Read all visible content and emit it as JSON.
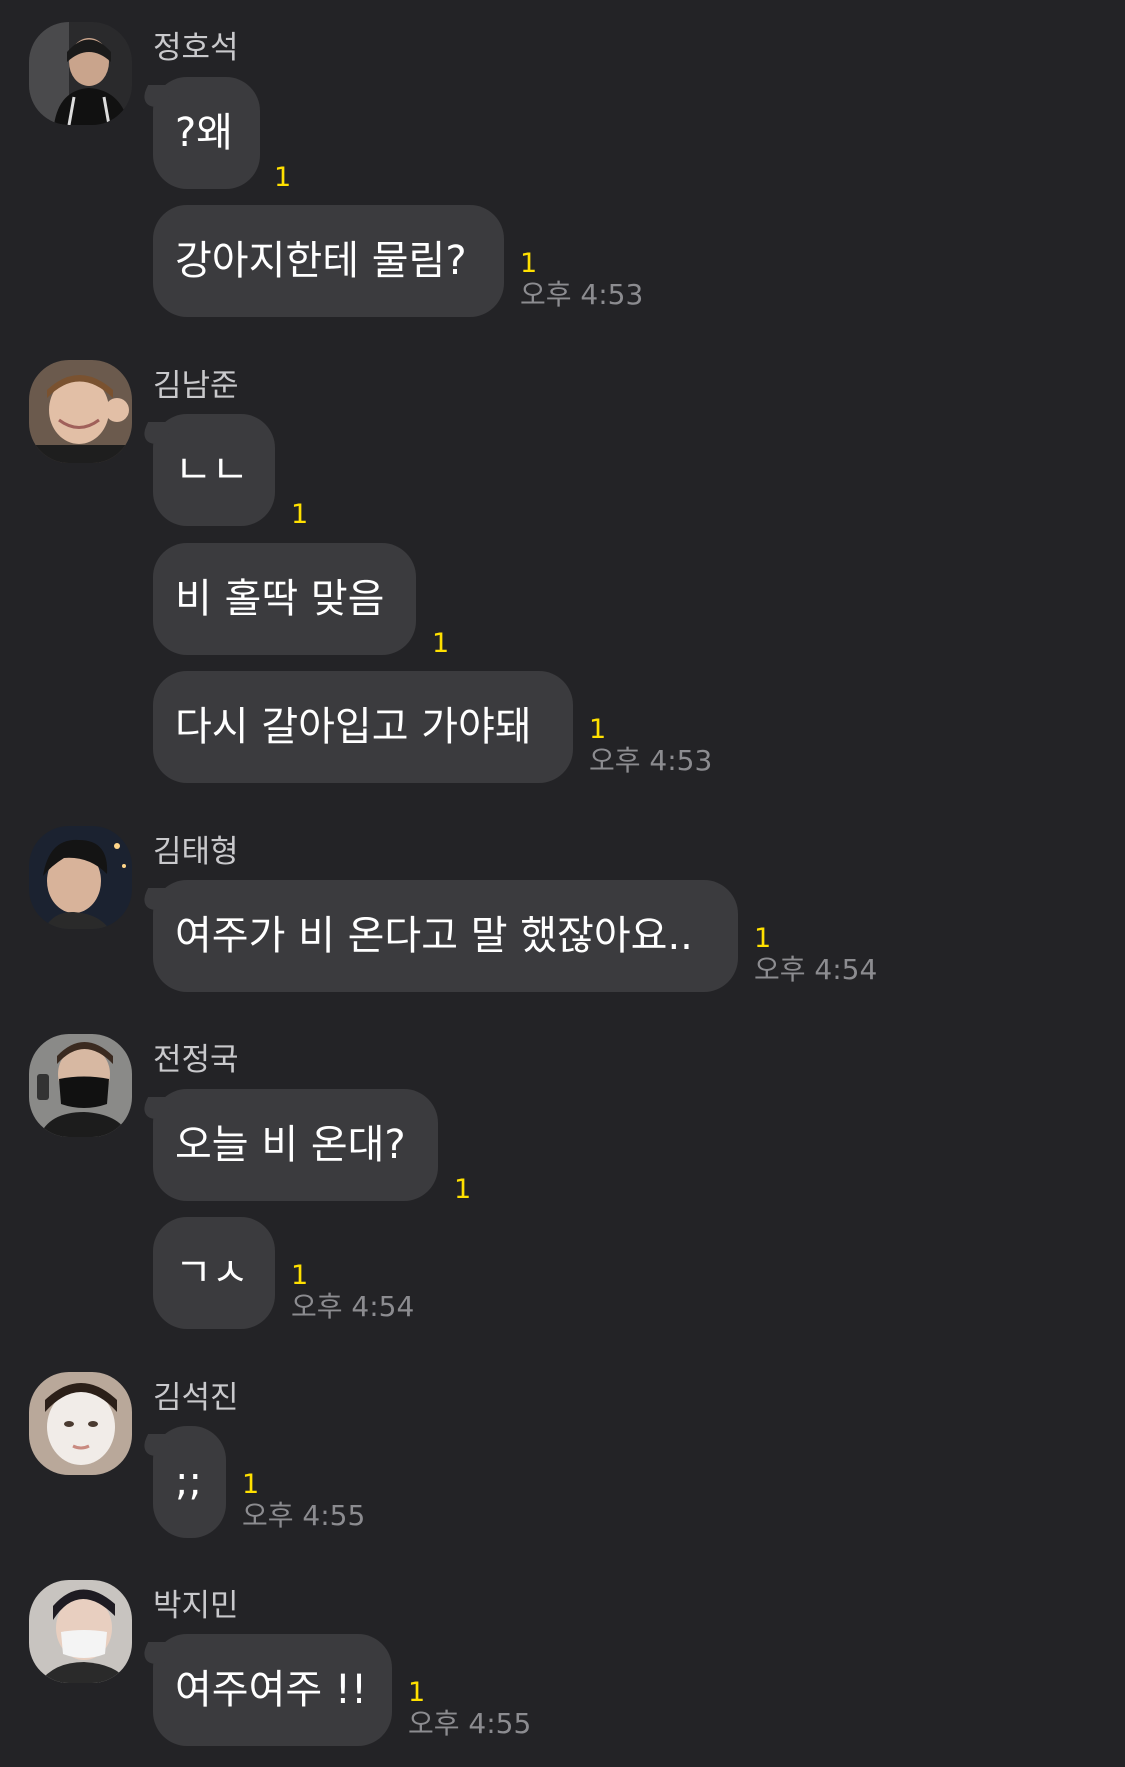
{
  "colors": {
    "background": "#232326",
    "bubble": "#3b3b3e",
    "unread": "#ffe000",
    "time": "#8c8c90",
    "sender": "#c9c9cc"
  },
  "groups": [
    {
      "sender": "정호석",
      "avatar": "profile-photo-hoseok",
      "messages": [
        {
          "text": "?왜",
          "unread": "1",
          "time": ""
        },
        {
          "text": "강아지한테 물림?",
          "unread": "1",
          "time": "오후 4:53"
        }
      ]
    },
    {
      "sender": "김남준",
      "avatar": "profile-photo-namjoon",
      "messages": [
        {
          "text": "ㄴㄴ",
          "unread": "1",
          "time": ""
        },
        {
          "text": "비 홀딱 맞음",
          "unread": "1",
          "time": ""
        },
        {
          "text": "다시 갈아입고 가야돼",
          "unread": "1",
          "time": "오후 4:53"
        }
      ]
    },
    {
      "sender": "김태형",
      "avatar": "profile-photo-taehyung",
      "messages": [
        {
          "text": "여주가 비 온다고 말 했잖아요..",
          "unread": "1",
          "time": "오후 4:54"
        }
      ]
    },
    {
      "sender": "전정국",
      "avatar": "profile-photo-jungkook",
      "messages": [
        {
          "text": "오늘 비 온대?",
          "unread": "1",
          "time": ""
        },
        {
          "text": "ㄱㅅ",
          "unread": "1",
          "time": "오후 4:54"
        }
      ]
    },
    {
      "sender": "김석진",
      "avatar": "profile-photo-seokjin",
      "messages": [
        {
          "text": ";;",
          "unread": "1",
          "time": "오후 4:55"
        }
      ]
    },
    {
      "sender": "박지민",
      "avatar": "profile-photo-jimin",
      "messages": [
        {
          "text": "여주여주 !!",
          "unread": "1",
          "time": "오후 4:55"
        }
      ]
    }
  ]
}
